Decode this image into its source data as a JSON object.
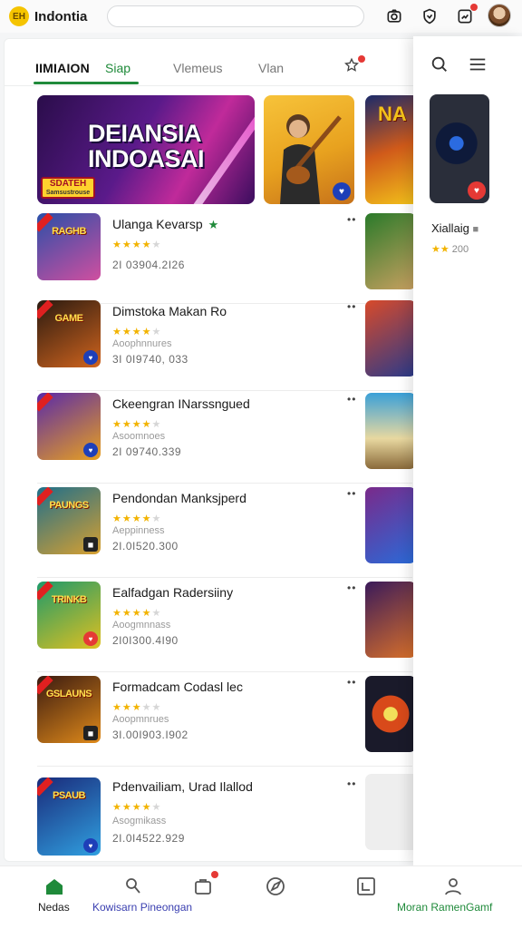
{
  "app": {
    "logo_text": "EH",
    "name": "Indontia"
  },
  "search": {
    "placeholder": ""
  },
  "top_icons": [
    "camera-icon",
    "shield-icon",
    "gift-icon",
    "avatar"
  ],
  "tabs": {
    "title": "IIMIAION",
    "items": [
      {
        "label": "Siap",
        "active": true
      },
      {
        "label": "Vlemeus",
        "active": false
      },
      {
        "label": "Vlan",
        "active": false
      }
    ]
  },
  "banner": {
    "title_line1": "DEIANSIA",
    "title_line2": "INDOASAI",
    "tag_title": "SDATEH",
    "tag_sub": "Samsustrouse"
  },
  "banner_art": {
    "third_label": "NA"
  },
  "list": [
    {
      "title": "Ulanga Kevarsp",
      "verified": true,
      "stars": 4,
      "sub": "",
      "meta": "2I 03904.2I26",
      "thumb_label": "RAGHB",
      "thumb_colors": [
        "#2a4fa8",
        "#d04fa0"
      ],
      "corner": "none"
    },
    {
      "title": "Dimstoka Makan Ro",
      "verified": false,
      "stars": 4,
      "sub": "Aoophnnures",
      "meta": "3I 0I9740, 033",
      "thumb_label": "GAME",
      "thumb_colors": [
        "#2a1a10",
        "#d0641e"
      ],
      "corner": "blue"
    },
    {
      "title": "Ckeengran INarssngued",
      "verified": false,
      "stars": 4,
      "sub": "Asoomnoes",
      "meta": "2I 09740.339",
      "thumb_label": "",
      "thumb_colors": [
        "#5a2aa8",
        "#e8a020"
      ],
      "corner": "blue"
    },
    {
      "title": "Pendondan Manksjperd",
      "verified": false,
      "stars": 4,
      "sub": "Aeppinness",
      "meta": "2I.0I520.300",
      "thumb_label": "PAUNGS",
      "thumb_colors": [
        "#1f6f8a",
        "#d8a030"
      ],
      "corner": "dark"
    },
    {
      "title": "Ealfadgan Radersiiny",
      "verified": false,
      "stars": 4,
      "sub": "Aoogmnnass",
      "meta": "2I0I300.4I90",
      "thumb_label": "TRINKB",
      "thumb_colors": [
        "#1e9a6a",
        "#e0c020"
      ],
      "corner": "red"
    },
    {
      "title": "Formadcam Codasl lec",
      "verified": false,
      "stars": 3,
      "sub": "Aoopmnrues",
      "meta": "3I.00I903.I902",
      "thumb_label": "GSLAUNS",
      "thumb_colors": [
        "#3a1a10",
        "#e08a1a"
      ],
      "corner": "dark"
    },
    {
      "title": "Pdenvailiam, Urad Ilallod",
      "verified": false,
      "stars": 4,
      "sub": "Asogmikass",
      "meta": "2I.0I4522.929",
      "thumb_label": "PSAUB",
      "thumb_colors": [
        "#1a2a7a",
        "#30a0e0"
      ],
      "corner": "blue"
    }
  ],
  "side_panel": {
    "title": "Xiallaig",
    "title_badge": "■",
    "rating_meta": "200"
  },
  "bottom_nav": [
    {
      "label": "Nedas",
      "icon": "home-icon",
      "active": true,
      "color": "#1a1a1a"
    },
    {
      "label": "Kowisarn Pineongan",
      "icon": "user-icon",
      "active": false,
      "color": "#3a3fb0"
    },
    {
      "label": "",
      "icon": "bag-icon",
      "active": false,
      "color": "#666"
    },
    {
      "label": "",
      "icon": "compass-icon",
      "active": false,
      "color": "#666"
    },
    {
      "label": "",
      "icon": "chart-icon",
      "active": false,
      "color": "#666"
    },
    {
      "label": "Moran RamenGamf",
      "icon": "profile-icon",
      "active": false,
      "color": "#1f8a3a"
    }
  ]
}
